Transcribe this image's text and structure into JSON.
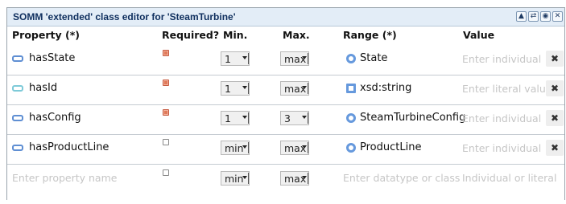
{
  "panel": {
    "title": "SOMM 'extended' class editor for 'SteamTurbine'",
    "buttons": [
      {
        "name": "move-up-icon",
        "glyph": "▲"
      },
      {
        "name": "swap-icon",
        "glyph": "⇄"
      },
      {
        "name": "settings-icon",
        "glyph": "◉"
      },
      {
        "name": "close-icon",
        "glyph": "✕"
      }
    ]
  },
  "columns": {
    "property": "Property (*)",
    "required": "Required?",
    "min": "Min.",
    "max": "Max.",
    "range": "Range (*)",
    "value": "Value"
  },
  "rows": [
    {
      "name": "hasState",
      "required": true,
      "min": "1",
      "max": "max",
      "range_kind": "class",
      "range": "State",
      "value_placeholder": "Enter individual",
      "delete_icon": "✖"
    },
    {
      "name": "hasId",
      "required": true,
      "min": "1",
      "max": "max",
      "range_kind": "datatype",
      "range": "xsd:string",
      "value_placeholder": "Enter literal value",
      "delete_icon": "✖"
    },
    {
      "name": "hasConfig",
      "required": true,
      "min": "1",
      "max": "3",
      "range_kind": "class",
      "range": "SteamTurbineConfig",
      "value_placeholder": "Enter individual",
      "delete_icon": "✖"
    },
    {
      "name": "hasProductLine",
      "required": false,
      "min": "min",
      "max": "max",
      "range_kind": "class",
      "range": "ProductLine",
      "value_placeholder": "Enter individual",
      "delete_icon": "✖"
    }
  ],
  "new_row": {
    "property_placeholder": "Enter property name",
    "required": false,
    "min": "min",
    "max": "max",
    "range_placeholder": "Enter datatype or class",
    "value_placeholder": "Individual or literal"
  },
  "colors": {
    "title_bg": "#e3edf7",
    "title_text": "#0f2f5e",
    "checkbox_on": "#e07a5a",
    "icon_blue": "#6699dd",
    "placeholder": "#c6c6c6"
  }
}
